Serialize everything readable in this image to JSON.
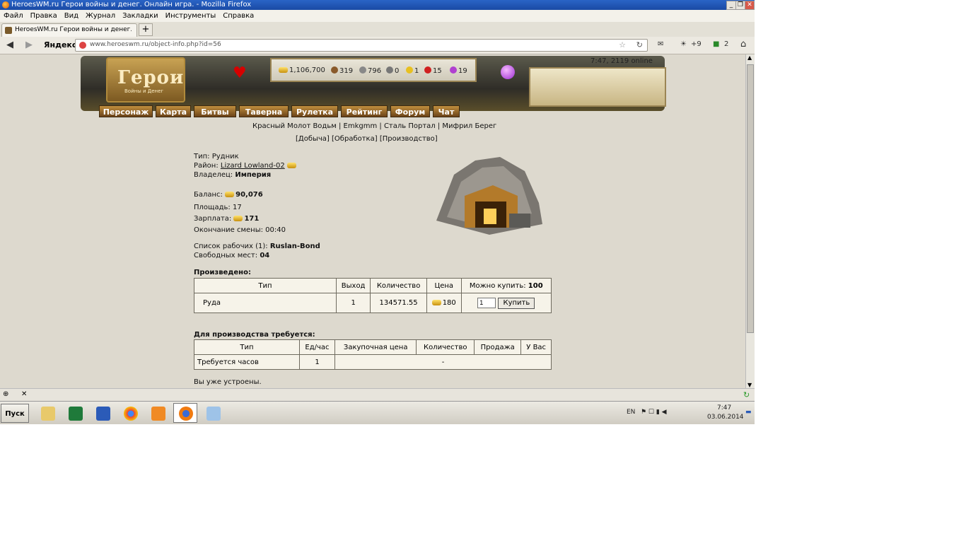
{
  "window": {
    "title": "HeroesWM.ru Герои войны и денег. Онлайн игра. - Mozilla Firefox",
    "buttons": [
      "_",
      "❐",
      "✕"
    ]
  },
  "menu": [
    "Файл",
    "Правка",
    "Вид",
    "Журнал",
    "Закладки",
    "Инструменты",
    "Справка"
  ],
  "tab": {
    "label": "HeroesWM.ru Герои войны и денег. Онли",
    "new_tab": "+"
  },
  "nav": {
    "back": "◀",
    "forward": "▶",
    "yandex": "Яндекс",
    "url": "www.heroeswm.ru/object-info.php?id=56",
    "extras": {
      "weather": "+9",
      "count": "2"
    }
  },
  "game": {
    "logo": {
      "title": "Герои",
      "subtitle": "Войны и Денег"
    },
    "clock": "7:47, 2119 online",
    "resources": [
      {
        "icon": "gold-icon",
        "color": "#e0b030",
        "value": "1,106,700"
      },
      {
        "icon": "wood-icon",
        "color": "#8a5a2b",
        "value": "319"
      },
      {
        "icon": "ore-icon",
        "color": "#888888",
        "value": "796"
      },
      {
        "icon": "mercury-icon",
        "color": "#777777",
        "value": "0"
      },
      {
        "icon": "sulfur-icon",
        "color": "#e8c020",
        "value": "1"
      },
      {
        "icon": "crystal-icon",
        "color": "#d02020",
        "value": "15"
      },
      {
        "icon": "gem-icon",
        "color": "#b040d0",
        "value": "19"
      }
    ],
    "main_menu": [
      "Персонаж",
      "Карта",
      "Битвы",
      "Таверна",
      "Рулетка",
      "Рейтинг",
      "Форум",
      "Чат"
    ],
    "sub_links": [
      "Красный Молот Водьм",
      "Emkgmm",
      "Сталь Портал",
      "Мифрил Берег"
    ],
    "object_tabs": [
      "[Добыча]",
      "[Обработка]",
      "[Производство]"
    ],
    "object": {
      "type_label": "Тип:",
      "type_value": "Рудник",
      "district_label": "Район:",
      "district_value": "Lizard Lowland-02",
      "owner_label": "Владелец:",
      "owner_value": "Империя",
      "balance_label": "Баланс:",
      "balance_value": "90,076",
      "area_label": "Площадь:",
      "area_value": "17",
      "salary_label": "Зарплата:",
      "salary_value": "171",
      "shift_label": "Окончание смены:",
      "shift_value": "00:40",
      "workers_label": "Список рабочих (1):",
      "workers_value": "Ruslan-Bond",
      "free_label": "Свободных мест:",
      "free_value": "04"
    },
    "produced": {
      "title": "Произведено:",
      "headers": [
        "Тип",
        "Выход",
        "Количество",
        "Цена",
        "Можно купить:",
        "100"
      ],
      "row": {
        "type": "Руда",
        "output": "1",
        "quantity": "134571.55",
        "price": "180",
        "qty_input": "1",
        "buy": "Купить"
      }
    },
    "required": {
      "title": "Для производства требуется:",
      "headers": [
        "Тип",
        "Ед/час",
        "Закупочная цена",
        "Количество",
        "Продажа",
        "У Вас"
      ],
      "row": {
        "type": "Требуется часов",
        "per_hour": "1",
        "dash": "-"
      }
    },
    "employed_note": "Вы уже устроены."
  },
  "taskbar": {
    "start": "Пуск",
    "lang": "EN",
    "time": "7:47",
    "date": "03.06.2014"
  }
}
